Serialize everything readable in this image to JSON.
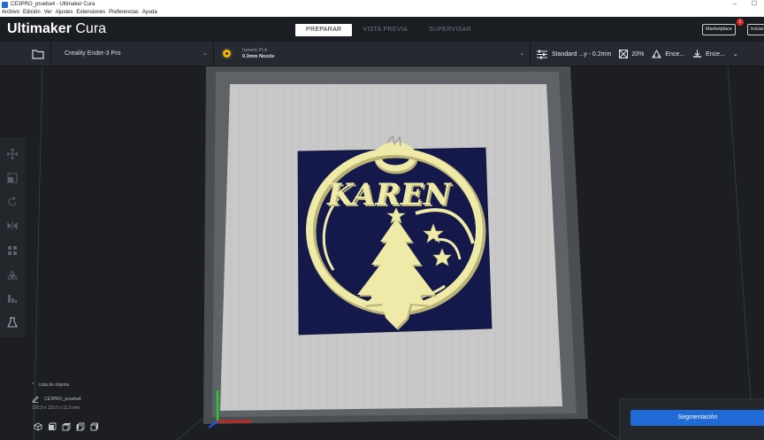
{
  "window": {
    "title": "CE3PRO_prueba4 - Ultimaker Cura",
    "controls": [
      "–",
      "☐"
    ]
  },
  "menu": [
    "Archivo",
    "Edición",
    "Ver",
    "Ajustes",
    "Extensiones",
    "Preferencias",
    "Ayuda"
  ],
  "header": {
    "brand_bold": "Ultimaker",
    "brand_light": "Cura",
    "stages": [
      "PREPARAR",
      "VISTA PREVIA",
      "SUPERVISAR"
    ],
    "active_stage": "PREPARAR",
    "marketplace_label": "Marketplace",
    "marketplace_badge": "1",
    "signin_label": "Iniciar"
  },
  "toolbar": {
    "printer": "Creality Ender-3 Pro",
    "material_name": "Generic PLA",
    "nozzle": "0.3mm Nozzle",
    "profile": "Standard ...y - 0.2mm",
    "infill": "20%",
    "support": "Ence...",
    "adhesion": "Ence..."
  },
  "viewport": {
    "model_text": "KAREN",
    "object_list_label": "Lista de objetos",
    "object_name": "CE3PRO_prueba4",
    "object_dims": "120.0 x 115.0 x 11.0 mm"
  },
  "actions": {
    "slice_label": "Segmentación"
  },
  "colors": {
    "accent": "#1f6ad6",
    "model": "#efeaa8",
    "model_shadow": "#b9b476",
    "backplate": "#14184a",
    "bed": "#c9c9c9",
    "app_bg": "#1c1e22"
  }
}
